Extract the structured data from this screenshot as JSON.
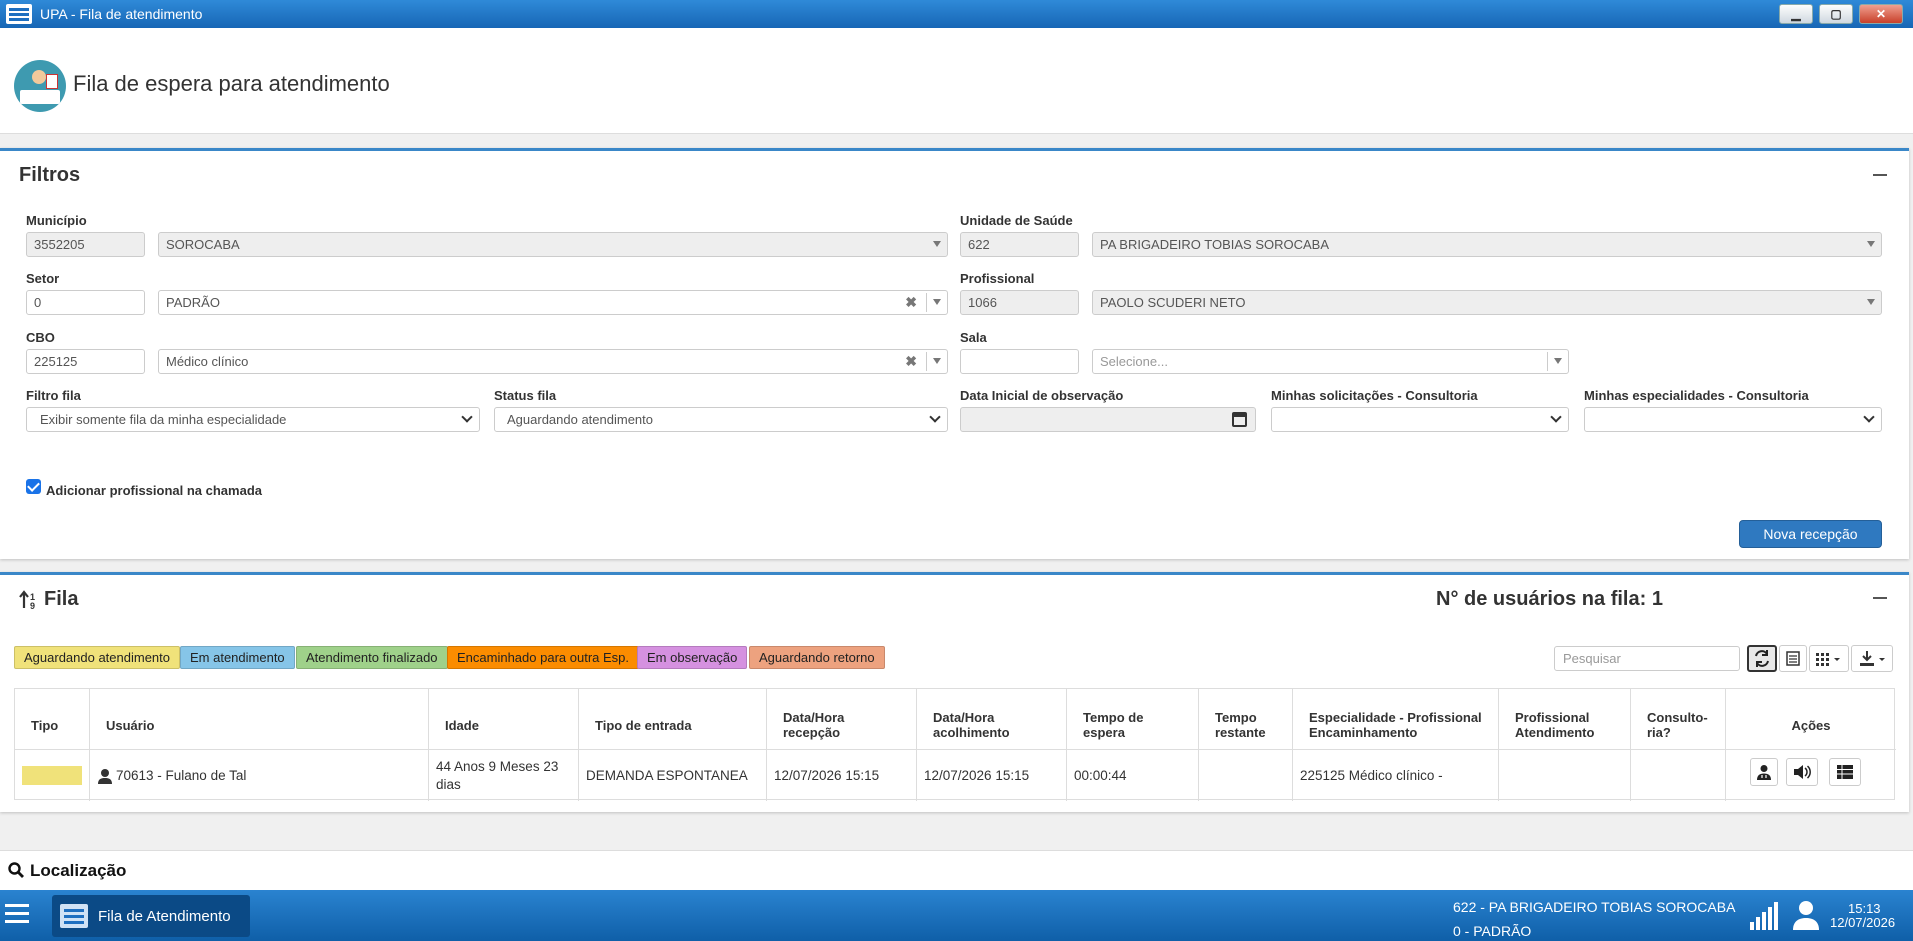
{
  "window": {
    "title": "UPA - Fila de atendimento",
    "min": "▁",
    "max": "▢",
    "close": "✕"
  },
  "page": {
    "title": "Fila de espera para atendimento"
  },
  "filtros": {
    "title": "Filtros",
    "municipio": {
      "label": "Município",
      "code": "3552205",
      "name": "SOROCABA"
    },
    "unidade": {
      "label": "Unidade de Saúde",
      "code": "622",
      "name": "PA BRIGADEIRO TOBIAS SOROCABA"
    },
    "setor": {
      "label": "Setor",
      "code": "0",
      "name": "PADRÃO"
    },
    "profissional": {
      "label": "Profissional",
      "code": "1066",
      "name": "PAOLO SCUDERI NETO"
    },
    "cbo": {
      "label": "CBO",
      "code": "225125",
      "name": "Médico clínico"
    },
    "sala": {
      "label": "Sala",
      "code": "",
      "placeholder": "Selecione..."
    },
    "filtro_fila": {
      "label": "Filtro fila",
      "value": "Exibir somente fila da minha especialidade"
    },
    "status_fila": {
      "label": "Status fila",
      "value": "Aguardando atendimento"
    },
    "data_inicial": {
      "label": "Data Inicial de observação",
      "value": ""
    },
    "minhas_solicitacoes": {
      "label": "Minhas solicitações - Consultoria",
      "value": ""
    },
    "minhas_especialidades": {
      "label": "Minhas especialidades - Consultoria",
      "value": ""
    },
    "adicionar_prof": {
      "label": "Adicionar profissional na chamada",
      "checked": true
    },
    "nova_recepcao": "Nova recepção",
    "clear": "✖"
  },
  "fila": {
    "title": "Fila",
    "count_label": "N° de usuários na fila: 1",
    "legend": [
      {
        "label": "Aguardando atendimento",
        "color": "#f0e27a"
      },
      {
        "label": "Em atendimento",
        "color": "#86c5e8"
      },
      {
        "label": "Atendimento finalizado",
        "color": "#9fd18a"
      },
      {
        "label": "Encaminhado para outra Esp.",
        "color": "#fb8c00"
      },
      {
        "label": "Em observação",
        "color": "#d591e0"
      },
      {
        "label": "Aguardando retorno",
        "color": "#eda27f"
      }
    ],
    "search_placeholder": "Pesquisar",
    "columns": [
      "Tipo",
      "Usuário",
      "Idade",
      "Tipo de entrada",
      "Data/Hora recepção",
      "Data/Hora acolhimento",
      "Tempo de espera",
      "Tempo restante",
      "Especialidade - Profissional Encaminhamento",
      "Profissional Atendimento",
      "Consulto-ria?",
      "Ações"
    ],
    "rows": [
      {
        "tipo_color": "#f0e27a",
        "usuario": "70613 - Fulano de Tal",
        "idade": "44 Anos 9 Meses 23 dias",
        "tipo_entrada": "DEMANDA ESPONTANEA",
        "recepcao": "12/07/2026 15:15",
        "acolhimento": "12/07/2026 15:15",
        "espera": "00:00:44",
        "restante": "",
        "especialidade": "225125 Médico clínico -",
        "prof_atend": "",
        "consultoria": ""
      }
    ]
  },
  "localizacao": {
    "title": "Localização"
  },
  "taskbar": {
    "task": "Fila de Atendimento",
    "unit": "622 - PA BRIGADEIRO TOBIAS SOROCABA",
    "setor": "0 - PADRÃO",
    "time": "15:13",
    "date": "12/07/2026"
  }
}
